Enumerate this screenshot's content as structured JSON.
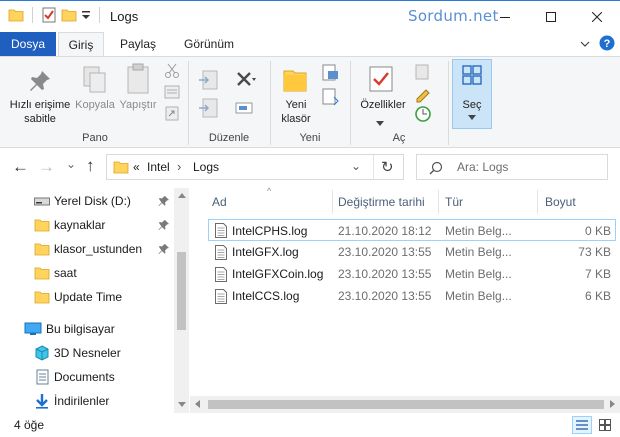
{
  "window": {
    "title": "Logs",
    "watermark": "Sordum.net",
    "controls": {
      "minimize": "—",
      "maximize": "☐",
      "close": "✕"
    }
  },
  "ribbon_tabs": {
    "file": "Dosya",
    "home": "Giriş",
    "share": "Paylaş",
    "view": "Görünüm",
    "expand": "⌄",
    "help": "?"
  },
  "ribbon": {
    "clipboard": {
      "pin_label_1": "Hızlı erişime",
      "pin_label_2": "sabitle",
      "copy": "Kopyala",
      "paste": "Yapıştır",
      "group": "Pano"
    },
    "organize": {
      "group": "Düzenle"
    },
    "new": {
      "new_folder_1": "Yeni",
      "new_folder_2": "klasör",
      "group": "Yeni"
    },
    "open": {
      "properties": "Özellikler",
      "group": "Aç"
    },
    "select": {
      "label": "Seç"
    }
  },
  "nav": {
    "back": "←",
    "forward": "→",
    "recent": "⌄",
    "up": "↑",
    "breadcrumb": {
      "overflow": "«",
      "parent": "Intel",
      "sep": "›",
      "current": "Logs"
    },
    "dropdown": "⌄",
    "refresh": "↻",
    "search_placeholder": "Ara: Logs"
  },
  "sidebar": {
    "items": [
      {
        "label": "Yerel Disk (D:)",
        "icon": "drive-icon"
      },
      {
        "label": "kaynaklar",
        "icon": "folder-icon"
      },
      {
        "label": "klasor_ustunden",
        "icon": "folder-icon"
      },
      {
        "label": "saat",
        "icon": "folder-icon"
      },
      {
        "label": "Update Time",
        "icon": "folder-icon"
      },
      {
        "label": "Bu bilgisayar",
        "icon": "computer-icon"
      },
      {
        "label": "3D Nesneler",
        "icon": "3d-objects-icon"
      },
      {
        "label": "Documents",
        "icon": "documents-icon"
      },
      {
        "label": "İndirilenler",
        "icon": "downloads-icon"
      }
    ]
  },
  "file_list": {
    "columns": [
      "Ad",
      "Değiştirme tarihi",
      "Tür",
      "Boyut"
    ],
    "sort_indicator": "^",
    "rows": [
      {
        "name": "IntelCPHS.log",
        "date": "21.10.2020 18:12",
        "type": "Metin Belg...",
        "size": "0 KB"
      },
      {
        "name": "IntelGFX.log",
        "date": "23.10.2020 13:55",
        "type": "Metin Belg...",
        "size": "73 KB"
      },
      {
        "name": "IntelGFXCoin.log",
        "date": "23.10.2020 13:55",
        "type": "Metin Belg...",
        "size": "7 KB"
      },
      {
        "name": "IntelCCS.log",
        "date": "23.10.2020 13:55",
        "type": "Metin Belg...",
        "size": "6 KB"
      }
    ]
  },
  "status": {
    "count": "4 öğe"
  },
  "colors": {
    "accent": "#1f5fbf",
    "selection_border": "#99d1ff",
    "folder": "#ffd35c"
  }
}
